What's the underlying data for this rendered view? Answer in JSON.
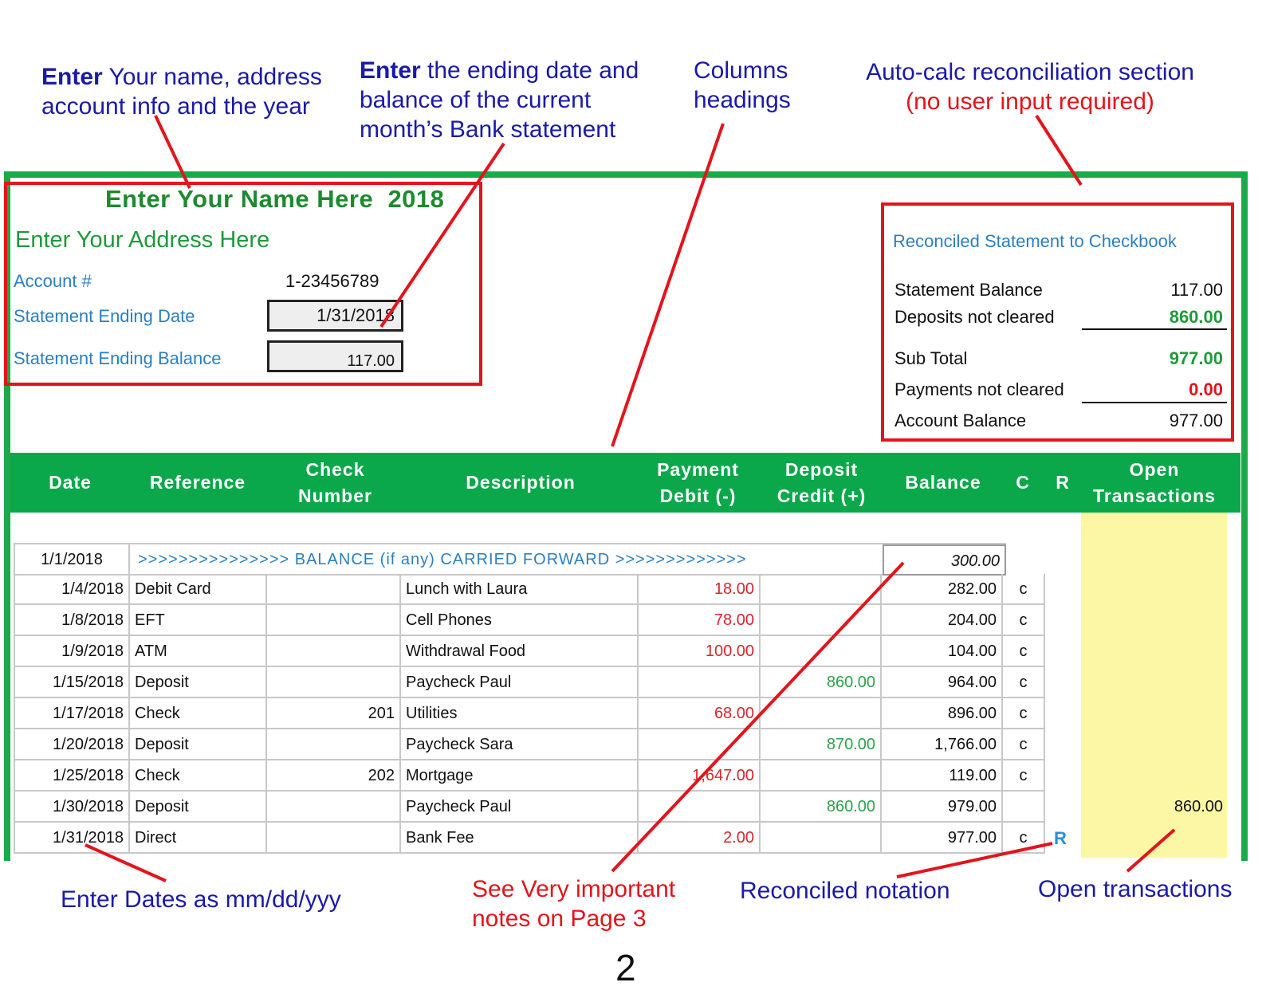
{
  "annotations": {
    "name_note": {
      "bold": "Enter",
      "line1": " Your name, address",
      "line2": "account info and the year"
    },
    "date_note": {
      "bold": "Enter",
      "line1": " the ending date and",
      "line2": "balance of the current",
      "line3": "month’s Bank statement"
    },
    "columns_note": {
      "line1": "Columns",
      "line2": "headings"
    },
    "autocalc_note": {
      "line1": "Auto-calc reconciliation section",
      "line2": "(no user input required)"
    },
    "dates_note": "Enter Dates as mm/dd/yyy",
    "important_note": {
      "line1": "See Very important",
      "line2": "notes on Page 3"
    },
    "reconciled_note": "Reconciled notation",
    "open_note": "Open transactions",
    "page_number": "2"
  },
  "account": {
    "name": "Enter Your Name Here",
    "year": "2018",
    "address": "Enter Your Address Here",
    "account_label": "Account #",
    "account_value": "1-23456789",
    "end_date_label": "Statement Ending Date",
    "end_date_value": "1/31/2018",
    "end_balance_label": "Statement Ending Balance",
    "end_balance_value": "117.00"
  },
  "reconcile": {
    "title": "Reconciled Statement to Checkbook",
    "statement_balance_label": "Statement Balance",
    "statement_balance": "117.00",
    "deposits_label": "Deposits not cleared",
    "deposits": "860.00",
    "subtotal_label": "Sub Total",
    "subtotal": "977.00",
    "payments_label": "Payments not cleared",
    "payments": "0.00",
    "account_balance_label": "Account Balance",
    "account_balance": "977.00"
  },
  "columns": {
    "date": "Date",
    "reference": "Reference",
    "check1": "Check",
    "check2": "Number",
    "description": "Description",
    "payment1": "Payment",
    "payment2": "Debit (-)",
    "deposit1": "Deposit",
    "deposit2": "Credit (+)",
    "balance": "Balance",
    "c": "C",
    "r": "R",
    "open1": "Open",
    "open2": "Transactions"
  },
  "carry_forward": {
    "date": "1/1/2018",
    "text": ">>>>>>>>>>>>>>> BALANCE (if any) CARRIED FORWARD >>>>>>>>>>>>>",
    "balance": "300.00"
  },
  "rows": [
    {
      "date": "1/4/2018",
      "ref": "Debit Card",
      "check": "",
      "desc": "Lunch with Laura",
      "payment": "18.00",
      "deposit": "",
      "balance": "282.00",
      "c": "c",
      "r": "",
      "open": ""
    },
    {
      "date": "1/8/2018",
      "ref": "EFT",
      "check": "",
      "desc": "Cell Phones",
      "payment": "78.00",
      "deposit": "",
      "balance": "204.00",
      "c": "c",
      "r": "",
      "open": ""
    },
    {
      "date": "1/9/2018",
      "ref": "ATM",
      "check": "",
      "desc": "Withdrawal Food",
      "payment": "100.00",
      "deposit": "",
      "balance": "104.00",
      "c": "c",
      "r": "",
      "open": ""
    },
    {
      "date": "1/15/2018",
      "ref": "Deposit",
      "check": "",
      "desc": "Paycheck Paul",
      "payment": "",
      "deposit": "860.00",
      "balance": "964.00",
      "c": "c",
      "r": "",
      "open": ""
    },
    {
      "date": "1/17/2018",
      "ref": "Check",
      "check": "201",
      "desc": "Utilities",
      "payment": "68.00",
      "deposit": "",
      "balance": "896.00",
      "c": "c",
      "r": "",
      "open": ""
    },
    {
      "date": "1/20/2018",
      "ref": "Deposit",
      "check": "",
      "desc": "Paycheck Sara",
      "payment": "",
      "deposit": "870.00",
      "balance": "1,766.00",
      "c": "c",
      "r": "",
      "open": ""
    },
    {
      "date": "1/25/2018",
      "ref": "Check",
      "check": "202",
      "desc": "Mortgage",
      "payment": "1,647.00",
      "deposit": "",
      "balance": "119.00",
      "c": "c",
      "r": "",
      "open": ""
    },
    {
      "date": "1/30/2018",
      "ref": "Deposit",
      "check": "",
      "desc": "Paycheck Paul",
      "payment": "",
      "deposit": "860.00",
      "balance": "979.00",
      "c": "",
      "r": "",
      "open": "860.00"
    },
    {
      "date": "1/31/2018",
      "ref": "Direct",
      "check": "",
      "desc": "Bank Fee",
      "payment": "2.00",
      "deposit": "",
      "balance": "977.00",
      "c": "c",
      "r": "R",
      "open": ""
    }
  ],
  "colors": {
    "green": "#0aa84a",
    "red": "#e3141b",
    "blue_note": "#1a1aa8",
    "label_blue": "#2b7fc0",
    "open_yellow": "#fbf7a4"
  }
}
